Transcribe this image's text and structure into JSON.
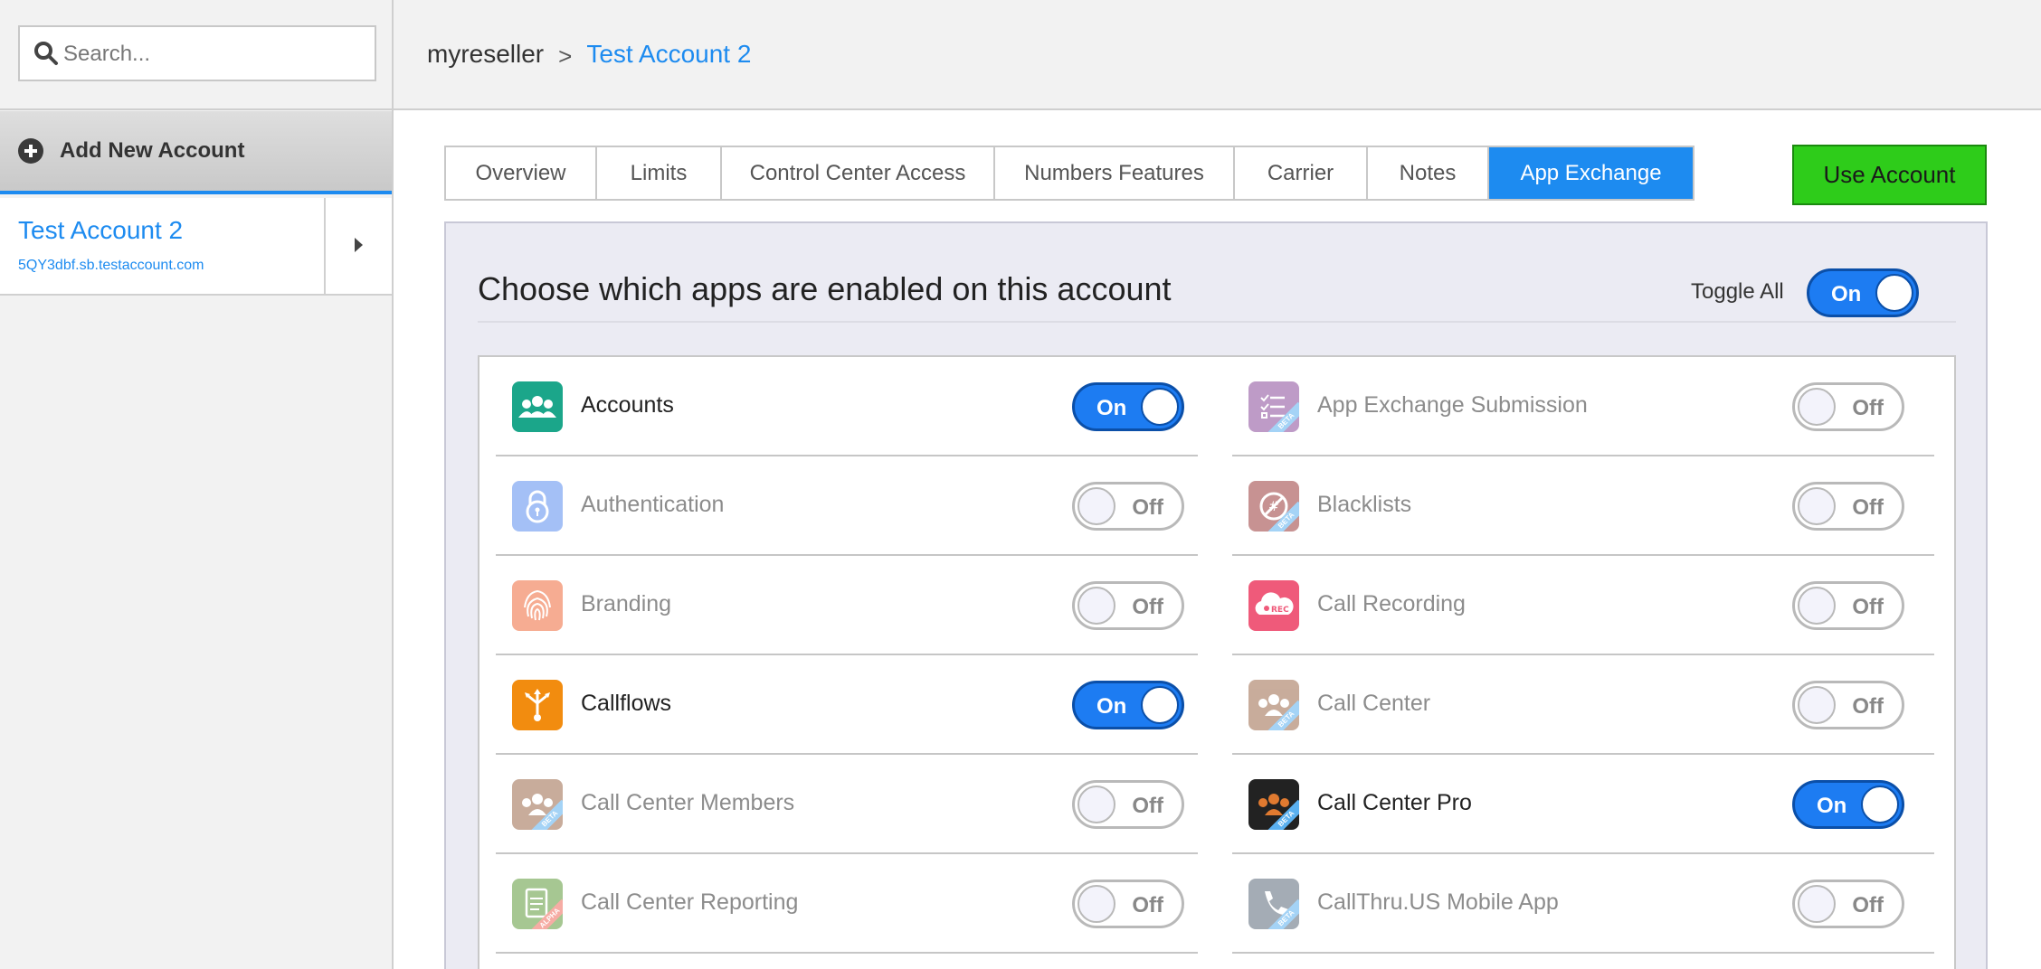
{
  "search": {
    "placeholder": "Search..."
  },
  "sidebar": {
    "add_label": "Add New Account",
    "account": {
      "name": "Test Account 2",
      "realm": "5QY3dbf.sb.testaccount.com"
    }
  },
  "breadcrumb": {
    "root": "myreseller",
    "separator": ">",
    "current": "Test Account 2"
  },
  "tabs": [
    {
      "label": "Overview"
    },
    {
      "label": "Limits"
    },
    {
      "label": "Control Center Access"
    },
    {
      "label": "Numbers Features"
    },
    {
      "label": "Carrier"
    },
    {
      "label": "Notes"
    },
    {
      "label": "App Exchange",
      "active": true
    }
  ],
  "use_account_label": "Use Account",
  "panel": {
    "title": "Choose which apps are enabled on this account",
    "toggle_all_label": "Toggle All",
    "toggle_all_state": "On"
  },
  "apps_left": [
    {
      "name": "Accounts",
      "state": "On",
      "icon": "accounts-icon",
      "color": "#1ba68a"
    },
    {
      "name": "Authentication",
      "state": "Off",
      "icon": "lock-icon",
      "color": "#5b8ef0"
    },
    {
      "name": "Branding",
      "state": "Off",
      "icon": "fingerprint-icon",
      "color": "#f06a3a"
    },
    {
      "name": "Callflows",
      "state": "On",
      "icon": "callflows-icon",
      "color": "#f28c0f"
    },
    {
      "name": "Call Center Members",
      "state": "Off",
      "icon": "call-center-members-icon",
      "color": "#9c6a4a",
      "badge": "BETA"
    },
    {
      "name": "Call Center Reporting",
      "state": "Off",
      "icon": "report-icon",
      "color": "#5f9a3a",
      "badge": "ALPHA"
    }
  ],
  "apps_right": [
    {
      "name": "App Exchange Submission",
      "state": "Off",
      "icon": "submission-list-icon",
      "color": "#8a4a9a",
      "badge": "BETA"
    },
    {
      "name": "Blacklists",
      "state": "Off",
      "icon": "blacklist-icon",
      "color": "#9a3a3a",
      "badge": "BETA"
    },
    {
      "name": "Call Recording",
      "state": "Off",
      "icon": "cloud-rec-icon",
      "color": "#ef5a7a"
    },
    {
      "name": "Call Center",
      "state": "Off",
      "icon": "call-center-icon",
      "color": "#9c6a4a",
      "badge": "BETA"
    },
    {
      "name": "Call Center Pro",
      "state": "On",
      "icon": "call-center-pro-icon",
      "color": "#222222",
      "badge": "BETA"
    },
    {
      "name": "CallThru.US Mobile App",
      "state": "Off",
      "icon": "phone-icon",
      "color": "#5a6a7a",
      "badge": "BETA"
    }
  ]
}
